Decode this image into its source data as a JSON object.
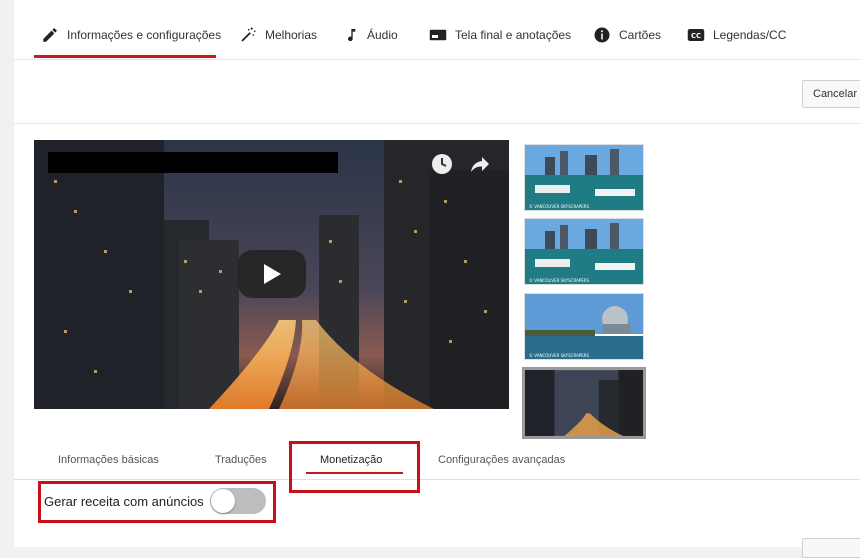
{
  "top_tabs": {
    "items": [
      {
        "label": "Informações e configurações",
        "icon": "pencil-icon"
      },
      {
        "label": "Melhorias",
        "icon": "magic-wand-icon"
      },
      {
        "label": "Áudio",
        "icon": "music-note-icon"
      },
      {
        "label": "Tela final e anotações",
        "icon": "end-screen-icon"
      },
      {
        "label": "Cartões",
        "icon": "info-icon"
      },
      {
        "label": "Legendas/CC",
        "icon": "cc-icon"
      }
    ],
    "active_index": 0
  },
  "toolbar": {
    "cancel_label": "Cancelar"
  },
  "player": {
    "state": "paused",
    "icons": [
      "clock-icon",
      "share-icon",
      "play-icon"
    ]
  },
  "thumbnails": {
    "captions": [
      "© VANCOUVER SKYSCRAPERS",
      "© VANCOUVER SKYSCRAPERS",
      "© VANCOUVER SKYSCRAPERS",
      ""
    ],
    "selected_index": 3
  },
  "sub_tabs": {
    "items": [
      "Informações básicas",
      "Traduções",
      "Monetização",
      "Configurações avançadas"
    ],
    "active_index": 2
  },
  "monetization": {
    "revenue_label": "Gerar receita com anúncios",
    "enabled": false
  },
  "colors": {
    "accent": "#cc1818",
    "highlight_box": "#c8101c",
    "toggle_off": "#bdbdbd"
  }
}
